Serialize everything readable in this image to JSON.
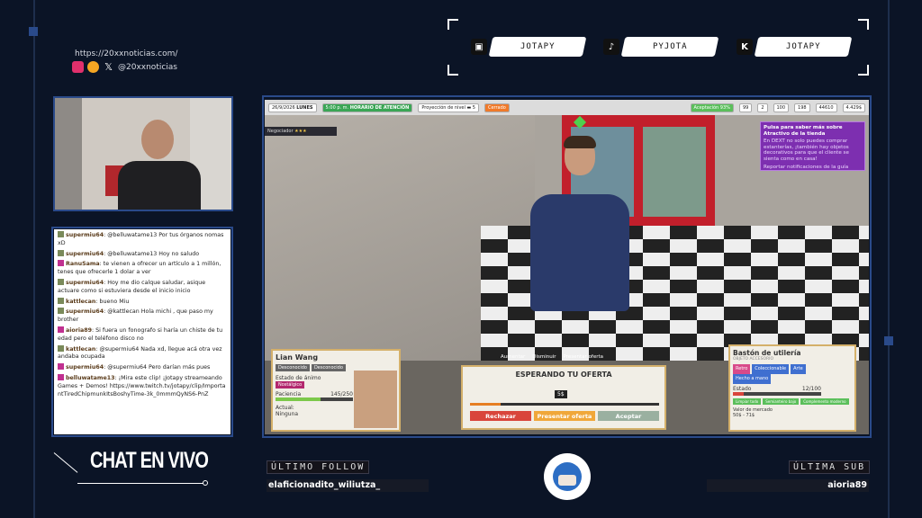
{
  "top_left": {
    "url": "https://20xxnoticias.com/",
    "handle": "@20xxnoticias"
  },
  "socials": [
    {
      "icon": "twitch-icon",
      "label": "JOTAPY"
    },
    {
      "icon": "tiktok-icon",
      "label": "PYJOTA"
    },
    {
      "icon": "kick-icon",
      "label": "JOTAPY"
    }
  ],
  "chat": {
    "title": "CHAT EN VIVO",
    "messages": [
      {
        "user": "supermiu64",
        "text": "@belluwatame13 Por tus órganos nomas xD"
      },
      {
        "user": "supermiu64",
        "text": "@belluwatame13 Hoy no saludo"
      },
      {
        "user": "RanuSama",
        "text": "te vienen a ofrecer un artículo a 1 millón, tenes que ofrecerle 1 dolar a ver"
      },
      {
        "user": "supermiu64",
        "text": "Hoy me dio calque saludar, asique actuare como si estuviera desde el inicio inicio"
      },
      {
        "user": "kattlecan",
        "text": "bueno Miu"
      },
      {
        "user": "supermiu64",
        "text": "@kattlecan Hola michi , que paso my brother"
      },
      {
        "user": "aioria89",
        "text": "Si fuera un fonografo si haría un chiste de tu edad pero el teléfono disco no"
      },
      {
        "user": "kattlecan",
        "text": "@supermiu64 Nada xd, llegue acá otra vez andaba ocupada"
      },
      {
        "user": "supermiu64",
        "text": "@supermiu64 Pero darían más pues"
      },
      {
        "user": "belluwatame13",
        "text": "¡Mira este clip! ¡Jotapy streameando Games + Demos! https://www.twitch.tv/jotapy/clip/ImportantTiredChipmunkItsBoshyTime-3k_0mmmQyNS6-PnZ"
      }
    ]
  },
  "game": {
    "hud": {
      "date": "26/9/2026",
      "day": "LUNES",
      "time": "5:00 p. m.",
      "status": "HORARIO DE ATENCIÓN",
      "projection_label": "Proyección de nivel",
      "stars": "5",
      "mood": "Cerrado",
      "acceptance": "Aceptación 93%",
      "v1": "99",
      "v2": "2",
      "v3": "100",
      "v4": "198",
      "money1": "44610",
      "money2": "4.429$"
    },
    "tip_title": "Pulsa para saber más sobre Atractivo de la tienda",
    "tip_body": "En DEXT no solo puedes comprar estanterías, ¡también hay objetos decorativos para que el cliente se sienta como en casa!",
    "tip_footer": "Reportar notificaciones de la guía",
    "negotiator_label": "Negociador",
    "customer": {
      "name": "Lian Wang",
      "tags": [
        "Desconocido",
        "Desconocido"
      ],
      "mood_label": "Estado de ánimo",
      "mood": "Nostálgico",
      "patience_label": "Paciencia",
      "patience": "145/250",
      "patience_value": 0.58,
      "current_label": "Actual:",
      "current": "Ninguna"
    },
    "controls": [
      "Aumentar",
      "Disminuir",
      "Presentar oferta"
    ],
    "offer": {
      "title": "ESPERANDO TU OFERTA",
      "price": "5$",
      "slider_value": 0.16,
      "reject": "Rechazar",
      "present": "Presentar oferta",
      "accept": "Aceptar"
    },
    "item": {
      "name": "Bastón de utilería",
      "subtitle": "OBJETO ACCESORIO",
      "tags": [
        "Retro",
        "Coleccionable",
        "Arte",
        "Hecho a mano"
      ],
      "state_label": "Estado",
      "state": "12/100",
      "state_value": 0.12,
      "extra_tags": [
        "Limpiar todo",
        "Semianteiro bajo",
        "Complemento moderno"
      ],
      "value_label": "Valor de mercado",
      "value": "50$ - 71$"
    }
  },
  "bottom": {
    "last_follow_label": "ÚLTIMO FOLLOW",
    "last_follow": "elaficionadito_wiliutza_",
    "last_sub_label": "ÚLTIMA SUB",
    "last_sub": "aioria89"
  },
  "colors": {
    "background": "#0b1426",
    "accent": "#2a4a8a",
    "reject": "#d9453b",
    "present": "#f0a73a",
    "accept": "#9ab0a0"
  }
}
